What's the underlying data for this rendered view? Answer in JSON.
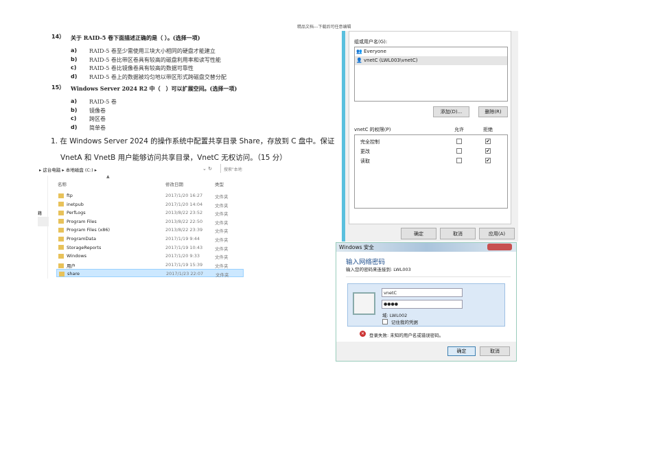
{
  "header": "精品文档---下载后可任意编辑",
  "q14": {
    "num": "14）",
    "text": "关于 RAID-5 卷下面描述正确的是（ ）。(选择一项)",
    "options": [
      {
        "l": "a)",
        "t": "RAID-5 卷至少需使用三块大小相同的硬盘才能建立"
      },
      {
        "l": "b)",
        "t": "RAID-5 卷比带区卷具有较高的磁盘利用率和读写性能"
      },
      {
        "l": "c)",
        "t": "RAID-5 卷比镜像卷具有较高的数据可靠性"
      },
      {
        "l": "d)",
        "t": "RAID-5 卷上的数据被均匀地以带区形式跨磁盘交替分配"
      }
    ]
  },
  "q15": {
    "num": "15）",
    "text": "Windows Server 2024 R2 中（　）可以扩展空间。(选择一项)",
    "options": [
      {
        "l": "a)",
        "t": "RAID-5 卷"
      },
      {
        "l": "b)",
        "t": "镜像卷"
      },
      {
        "l": "c)",
        "t": "跨区卷"
      },
      {
        "l": "d)",
        "t": "简单卷"
      }
    ]
  },
  "task": {
    "line1": "1. 在 Windows Server 2024 的操作系统中配置共享目录 Share，存放到 C 盘中。保证",
    "line2": "VnetA 和 VnetB 用户能够访问共享目录，VnetC 无权访问。（15 分）"
  },
  "explorer": {
    "crumbs": [
      "这台电脑",
      "本地磁盘 (C:)"
    ],
    "search_placeholder": "搜索\"本地",
    "columns": [
      "名称",
      "修改日期",
      "类型"
    ],
    "side_label": "籍",
    "rows": [
      {
        "name": "ftp",
        "date": "2017/1/20 16:27",
        "type": "文件夹"
      },
      {
        "name": "inetpub",
        "date": "2017/1/20 14:04",
        "type": "文件夹"
      },
      {
        "name": "PerfLogs",
        "date": "2013/8/22 23:52",
        "type": "文件夹"
      },
      {
        "name": "Program Files",
        "date": "2013/8/22 22:50",
        "type": "文件夹"
      },
      {
        "name": "Program Files (x86)",
        "date": "2013/8/22 23:39",
        "type": "文件夹"
      },
      {
        "name": "ProgramData",
        "date": "2017/1/19 9:44",
        "type": "文件夹"
      },
      {
        "name": "StorageReports",
        "date": "2017/1/19 10:43",
        "type": "文件夹"
      },
      {
        "name": "Windows",
        "date": "2017/1/20 9:33",
        "type": "文件夹"
      },
      {
        "name": "用户",
        "date": "2017/1/19 15:39",
        "type": "文件夹"
      },
      {
        "name": "share",
        "date": "2017/1/23 22:07",
        "type": "文件夹",
        "selected": true
      }
    ]
  },
  "security": {
    "group_label": "组或用户名(G):",
    "users": [
      "Everyone",
      "vnetC (LWL003\\vnetC)"
    ],
    "add": "添加(D)...",
    "remove": "删除(R)",
    "perm_label": "vnetC 的权限(P)",
    "allow": "允许",
    "deny": "拒绝",
    "perms": [
      {
        "name": "完全控制",
        "allow": false,
        "deny": true
      },
      {
        "name": "更改",
        "allow": false,
        "deny": true
      },
      {
        "name": "读取",
        "allow": false,
        "deny": true
      }
    ],
    "ok": "确定",
    "cancel": "取消",
    "apply": "应用(A)"
  },
  "login": {
    "window_title": "Windows 安全",
    "heading": "输入网络密码",
    "subtitle": "输入您的密码来连接到: LWL003",
    "username": "vnetC",
    "password": "●●●●",
    "domain": "域: LWL002",
    "remember": "记住我的凭据",
    "error": "登录失败: 未知的用户名或错误密码。",
    "ok": "确定",
    "cancel": "取消"
  }
}
